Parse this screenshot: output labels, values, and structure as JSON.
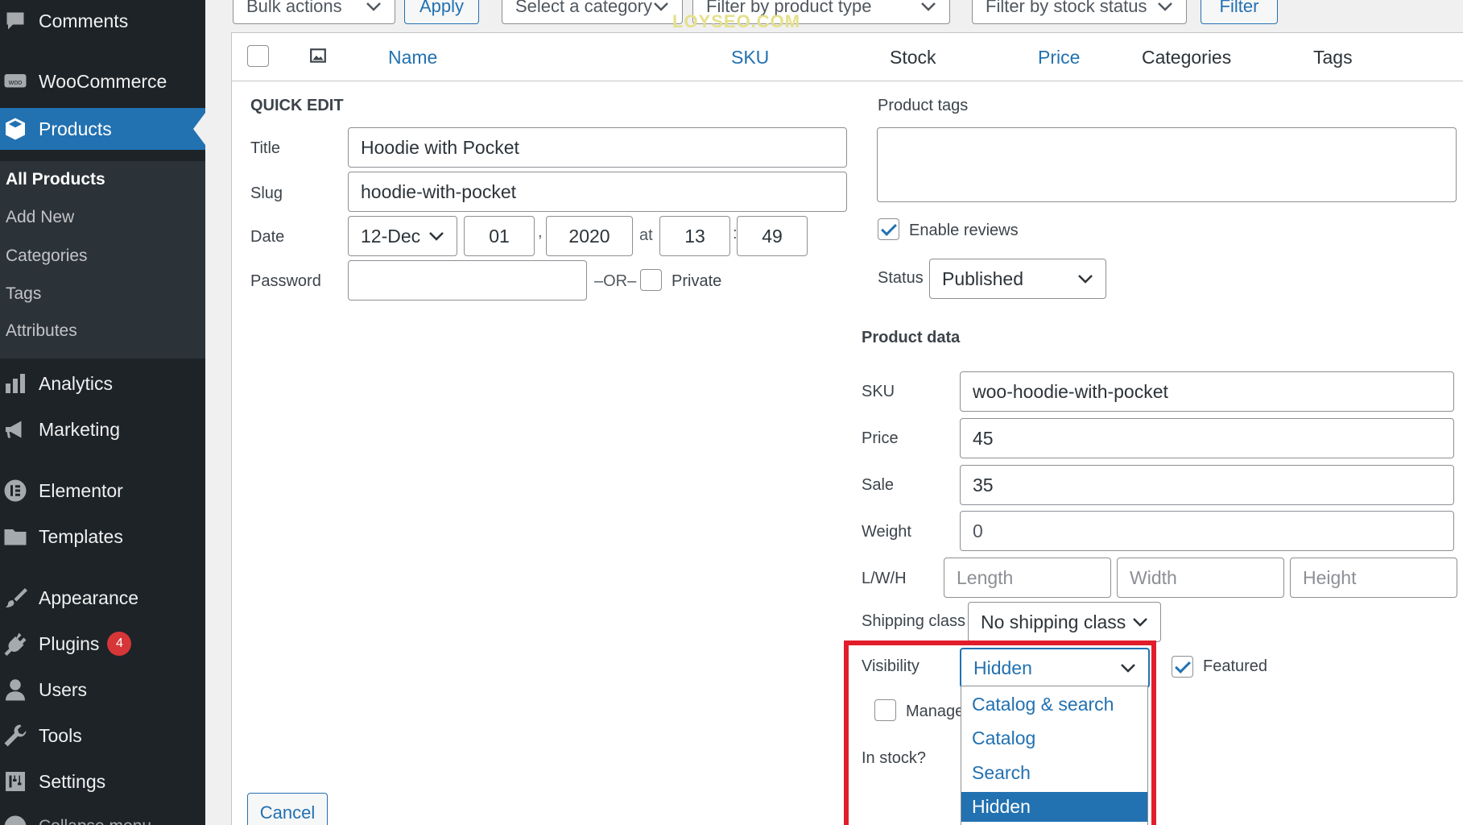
{
  "sidebar": {
    "items": [
      {
        "name": "comments",
        "label": "Comments",
        "icon": "comment-icon"
      },
      {
        "name": "woocommerce",
        "label": "WooCommerce",
        "icon": "woo-icon"
      },
      {
        "name": "products",
        "label": "Products",
        "icon": "box-icon",
        "active": true
      },
      {
        "name": "analytics",
        "label": "Analytics",
        "icon": "bar-chart-icon"
      },
      {
        "name": "marketing",
        "label": "Marketing",
        "icon": "megaphone-icon"
      },
      {
        "name": "elementor",
        "label": "Elementor",
        "icon": "elementor-icon"
      },
      {
        "name": "templates",
        "label": "Templates",
        "icon": "folder-icon"
      },
      {
        "name": "appearance",
        "label": "Appearance",
        "icon": "brush-icon"
      },
      {
        "name": "plugins",
        "label": "Plugins",
        "icon": "plug-icon",
        "badge": "4"
      },
      {
        "name": "users",
        "label": "Users",
        "icon": "user-icon"
      },
      {
        "name": "tools",
        "label": "Tools",
        "icon": "wrench-icon"
      },
      {
        "name": "settings",
        "label": "Settings",
        "icon": "sliders-icon"
      },
      {
        "name": "collapse",
        "label": "Collapse menu",
        "icon": "collapse-icon"
      }
    ],
    "submenu": [
      "All Products",
      "Add New",
      "Categories",
      "Tags",
      "Attributes"
    ]
  },
  "toolbar": {
    "bulk_actions": "Bulk actions",
    "apply": "Apply",
    "category": "Select a category",
    "product_type": "Filter by product type",
    "stock_status": "Filter by stock status",
    "filter": "Filter",
    "watermark": "LOYSEO.COM"
  },
  "table": {
    "columns": {
      "name": "Name",
      "sku": "SKU",
      "stock": "Stock",
      "price": "Price",
      "categories": "Categories",
      "tags": "Tags"
    }
  },
  "quick_edit": {
    "heading": "QUICK EDIT",
    "title_label": "Title",
    "title_value": "Hoodie with Pocket",
    "slug_label": "Slug",
    "slug_value": "hoodie-with-pocket",
    "date_label": "Date",
    "date_month": "12-Dec",
    "date_day": "01",
    "date_year": "2020",
    "date_at": "at",
    "date_hour": "13",
    "date_minute": "49",
    "password_label": "Password",
    "password_value": "",
    "or_text": "–OR–",
    "private_label": "Private",
    "cancel": "Cancel"
  },
  "right": {
    "tags_label": "Product tags",
    "tags_value": "",
    "enable_reviews": "Enable reviews",
    "status_label": "Status",
    "status_value": "Published",
    "product_data_heading": "Product data",
    "sku_label": "SKU",
    "sku_value": "woo-hoodie-with-pocket",
    "price_label": "Price",
    "price_value": "45",
    "sale_label": "Sale",
    "sale_value": "35",
    "weight_label": "Weight",
    "weight_value": "0",
    "lwh_label": "L/W/H",
    "length_placeholder": "Length",
    "width_placeholder": "Width",
    "height_placeholder": "Height",
    "shipping_label": "Shipping class",
    "shipping_value": "No shipping class",
    "visibility_label": "Visibility",
    "visibility_value": "Hidden",
    "visibility_options": [
      "Catalog & search",
      "Catalog",
      "Search",
      "Hidden"
    ],
    "featured_label": "Featured",
    "manage_label": "Manage",
    "instock_label": "In stock?"
  },
  "colors": {
    "accent": "#2271b1",
    "highlight": "#e11d2b",
    "sidebar": "#1d2327"
  }
}
